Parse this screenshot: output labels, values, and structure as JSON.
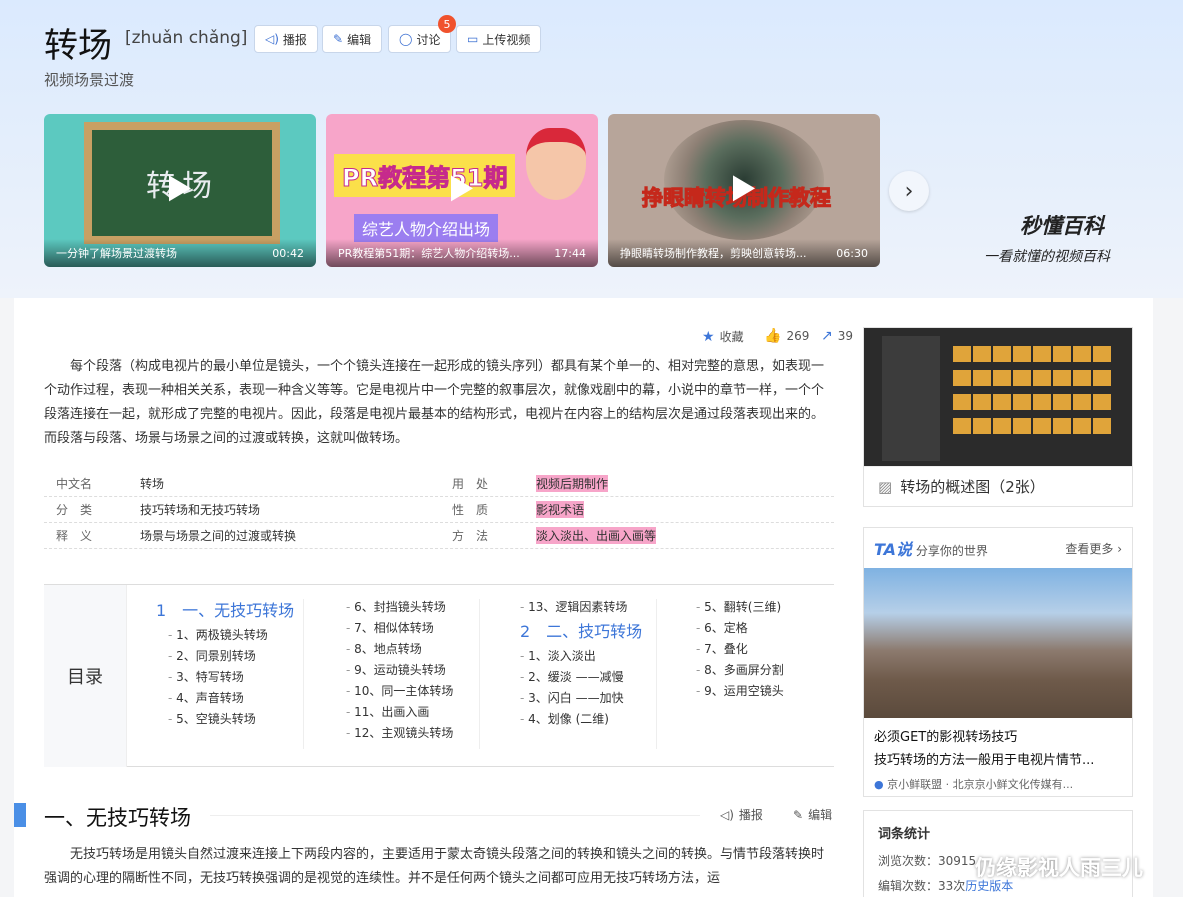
{
  "header": {
    "title": "转场",
    "pinyin": "[zhuǎn chǎng]",
    "subtitle": "视频场景过渡",
    "buttons": {
      "broadcast": "播报",
      "edit": "编辑",
      "discuss": "讨论",
      "upload": "上传视频"
    },
    "discuss_badge": "5"
  },
  "videos": [
    {
      "board_text": "转场",
      "caption": "一分钟了解场景过渡转场",
      "duration": "00:42"
    },
    {
      "banner": "PR教程第51期",
      "banner2": "综艺人物介绍出场",
      "caption": "PR教程第51期：综艺人物介绍转场...",
      "duration": "17:44"
    },
    {
      "banner": "挣眼睛转场制作教程",
      "caption": "挣眼睛转场制作教程，剪映创意转场...",
      "duration": "06:30"
    }
  ],
  "brand": {
    "logo": "秒懂百科",
    "slogan": "一看就懂的视频百科"
  },
  "actions": {
    "collect": "收藏",
    "like_count": "269",
    "share_count": "39"
  },
  "intro": "每个段落（构成电视片的最小单位是镜头，一个个镜头连接在一起形成的镜头序列）都具有某个单一的、相对完整的意思，如表现一个动作过程，表现一种相关关系，表现一种含义等等。它是电视片中一个完整的叙事层次，就像戏剧中的幕，小说中的章节一样，一个个段落连接在一起，就形成了完整的电视片。因此，段落是电视片最基本的结构形式，电视片在内容上的结构层次是通过段落表现出来的。而段落与段落、场景与场景之间的过渡或转换，这就叫做转场。",
  "info": [
    {
      "k1": "中文名",
      "v1": "转场",
      "k2": "用　处",
      "v2": "视频后期制作"
    },
    {
      "k1": "分　类",
      "v1": "技巧转场和无技巧转场",
      "k2": "性　质",
      "v2": "影视术语"
    },
    {
      "k1": "释　义",
      "v1": "场景与场景之间的过渡或转换",
      "k2": "方　法",
      "v2": "淡入淡出、出画入画等"
    }
  ],
  "toc": {
    "label": "目录",
    "col1": [
      "1　一、无技巧转场",
      "1、两极镜头转场",
      "2、同景别转场",
      "3、特写转场",
      "4、声音转场",
      "5、空镜头转场"
    ],
    "col2": [
      "6、封挡镜头转场",
      "7、相似体转场",
      "8、地点转场",
      "9、运动镜头转场",
      "10、同一主体转场",
      "11、出画入画",
      "12、主观镜头转场"
    ],
    "col3": [
      "13、逻辑因素转场",
      "2　二、技巧转场",
      "1、淡入淡出",
      "2、缓淡 ——减慢",
      "3、闪白 ——加快",
      "4、划像 (二维)"
    ],
    "col4": [
      "5、翻转(三维)",
      "6、定格",
      "7、叠化",
      "8、多画屏分割",
      "9、运用空镜头"
    ]
  },
  "section": {
    "title": "一、无技巧转场",
    "broadcast": "播报",
    "edit": "编辑",
    "text": "无技巧转场是用镜头自然过渡来连接上下两段内容的，主要适用于蒙太奇镜头段落之间的转换和镜头之间的转换。与情节段落转换时强调的心理的隔断性不同，无技巧转换强调的是视觉的连续性。并不是任何两个镜头之间都可应用无技巧转场方法，运"
  },
  "sidebar": {
    "gallery_caption": "转场的概述图（2张）",
    "ta_logo": "TA说",
    "ta_slogan": "分享你的世界",
    "ta_more": "查看更多",
    "ta_title": "必须GET的影视转场技巧",
    "ta_desc": "技巧转场的方法一般用于电视片情节...",
    "ta_source": "京小鲜联盟 · 北京京小鲜文化传媒有...",
    "stats_title": "词条统计",
    "views_label": "浏览次数：",
    "views_value": "30915",
    "edits_label": "编辑次数：",
    "edits_value": "33次",
    "history_link": "历史版本"
  },
  "watermark": "仍缘影视人雨三儿",
  "colors": {
    "accent": "#3d76d8",
    "badge": "#f0522d",
    "section_bar": "#4a8fe6"
  }
}
